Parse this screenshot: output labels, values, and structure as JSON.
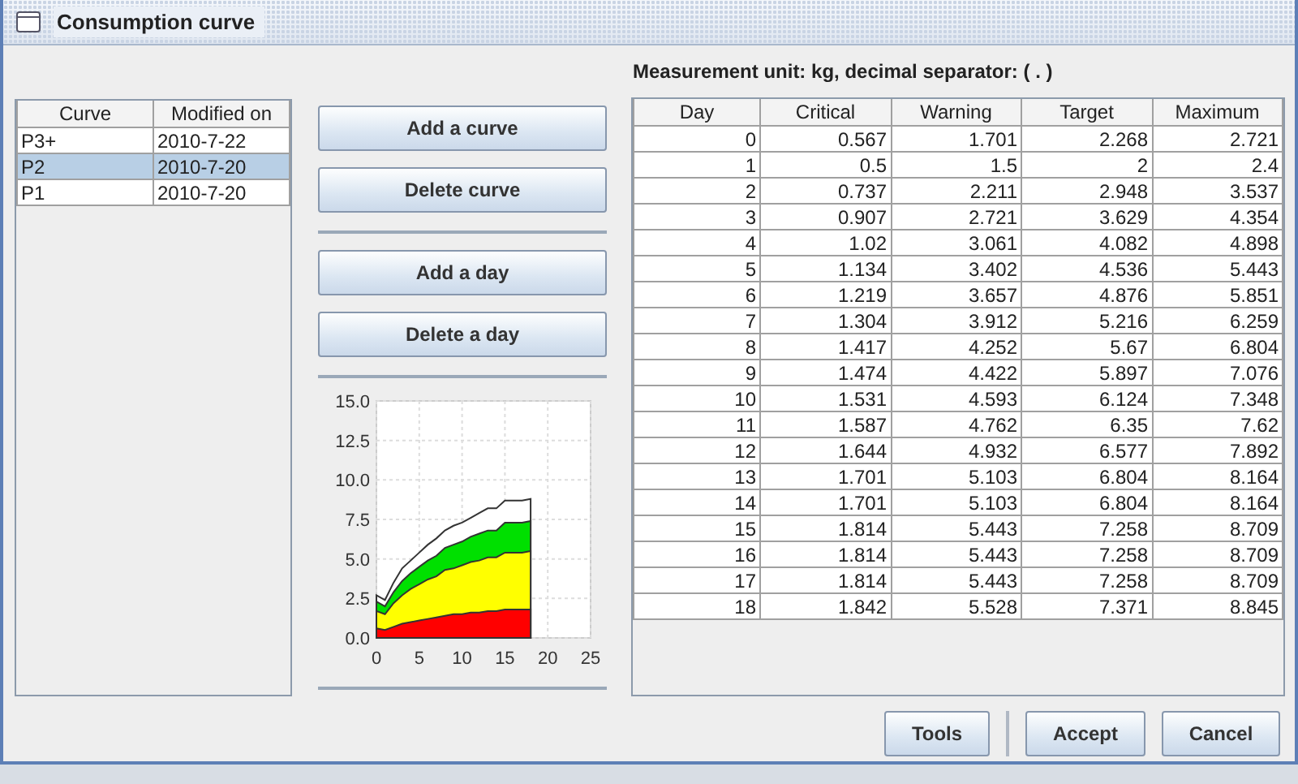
{
  "window": {
    "title": "Consumption curve"
  },
  "curves": {
    "columns": [
      "Curve",
      "Modified on"
    ],
    "rows": [
      {
        "cells": [
          "P3+",
          "2010-7-22"
        ],
        "selected": false
      },
      {
        "cells": [
          "P2",
          "2010-7-20"
        ],
        "selected": true
      },
      {
        "cells": [
          "P1",
          "2010-7-20"
        ],
        "selected": false
      }
    ]
  },
  "actions": {
    "curve_buttons": [
      "Add a curve",
      "Delete curve"
    ],
    "day_buttons": [
      "Add a day",
      "Delete a day"
    ]
  },
  "chart": {
    "chart_data": {
      "type": "area",
      "grid": true,
      "x": [
        0,
        1,
        2,
        3,
        4,
        5,
        6,
        7,
        8,
        9,
        10,
        11,
        12,
        13,
        14,
        15,
        16,
        17,
        18
      ],
      "xlim": [
        0,
        25
      ],
      "ylim": [
        0,
        15
      ],
      "xticks": [
        0,
        5,
        10,
        15,
        20,
        25
      ],
      "yticks": [
        {
          "value": 0,
          "label": "0.0"
        },
        {
          "value": 2.5,
          "label": "2.5"
        },
        {
          "value": 5,
          "label": "5.0"
        },
        {
          "value": 7.5,
          "label": "7.5"
        },
        {
          "value": 10,
          "label": "10.0"
        },
        {
          "value": 12.5,
          "label": "12.5"
        },
        {
          "value": 15,
          "label": "15.0"
        }
      ],
      "series": [
        {
          "color": "#ff0000",
          "values": [
            0.6,
            0.5,
            0.7,
            0.9,
            1.0,
            1.1,
            1.2,
            1.3,
            1.4,
            1.5,
            1.5,
            1.6,
            1.6,
            1.7,
            1.7,
            1.8,
            1.8,
            1.8,
            1.8
          ]
        },
        {
          "color": "#ffff00",
          "values": [
            1.7,
            1.5,
            2.2,
            2.7,
            3.1,
            3.4,
            3.7,
            3.9,
            4.3,
            4.4,
            4.6,
            4.8,
            4.9,
            5.1,
            5.1,
            5.4,
            5.4,
            5.4,
            5.5
          ]
        },
        {
          "color": "#00e000",
          "values": [
            2.3,
            2.0,
            2.9,
            3.6,
            4.1,
            4.5,
            4.9,
            5.2,
            5.7,
            5.9,
            6.1,
            6.4,
            6.6,
            6.8,
            6.8,
            7.3,
            7.3,
            7.3,
            7.4
          ]
        },
        {
          "color": "#ffffff",
          "values": [
            2.7,
            2.4,
            3.5,
            4.4,
            4.9,
            5.4,
            5.9,
            6.3,
            6.8,
            7.1,
            7.3,
            7.6,
            7.9,
            8.2,
            8.2,
            8.7,
            8.7,
            8.7,
            8.8
          ]
        }
      ]
    }
  },
  "unit_label": "Measurement unit: kg, decimal separator: ( . )",
  "days": {
    "columns": [
      "Day",
      "Critical",
      "Warning",
      "Target",
      "Maximum"
    ],
    "rows": [
      [
        "0",
        "0.567",
        "1.701",
        "2.268",
        "2.721"
      ],
      [
        "1",
        "0.5",
        "1.5",
        "2",
        "2.4"
      ],
      [
        "2",
        "0.737",
        "2.211",
        "2.948",
        "3.537"
      ],
      [
        "3",
        "0.907",
        "2.721",
        "3.629",
        "4.354"
      ],
      [
        "4",
        "1.02",
        "3.061",
        "4.082",
        "4.898"
      ],
      [
        "5",
        "1.134",
        "3.402",
        "4.536",
        "5.443"
      ],
      [
        "6",
        "1.219",
        "3.657",
        "4.876",
        "5.851"
      ],
      [
        "7",
        "1.304",
        "3.912",
        "5.216",
        "6.259"
      ],
      [
        "8",
        "1.417",
        "4.252",
        "5.67",
        "6.804"
      ],
      [
        "9",
        "1.474",
        "4.422",
        "5.897",
        "7.076"
      ],
      [
        "10",
        "1.531",
        "4.593",
        "6.124",
        "7.348"
      ],
      [
        "11",
        "1.587",
        "4.762",
        "6.35",
        "7.62"
      ],
      [
        "12",
        "1.644",
        "4.932",
        "6.577",
        "7.892"
      ],
      [
        "13",
        "1.701",
        "5.103",
        "6.804",
        "8.164"
      ],
      [
        "14",
        "1.701",
        "5.103",
        "6.804",
        "8.164"
      ],
      [
        "15",
        "1.814",
        "5.443",
        "7.258",
        "8.709"
      ],
      [
        "16",
        "1.814",
        "5.443",
        "7.258",
        "8.709"
      ],
      [
        "17",
        "1.814",
        "5.443",
        "7.258",
        "8.709"
      ],
      [
        "18",
        "1.842",
        "5.528",
        "7.371",
        "8.845"
      ]
    ]
  },
  "buttons": [
    "Tools",
    "Accept",
    "Cancel"
  ]
}
